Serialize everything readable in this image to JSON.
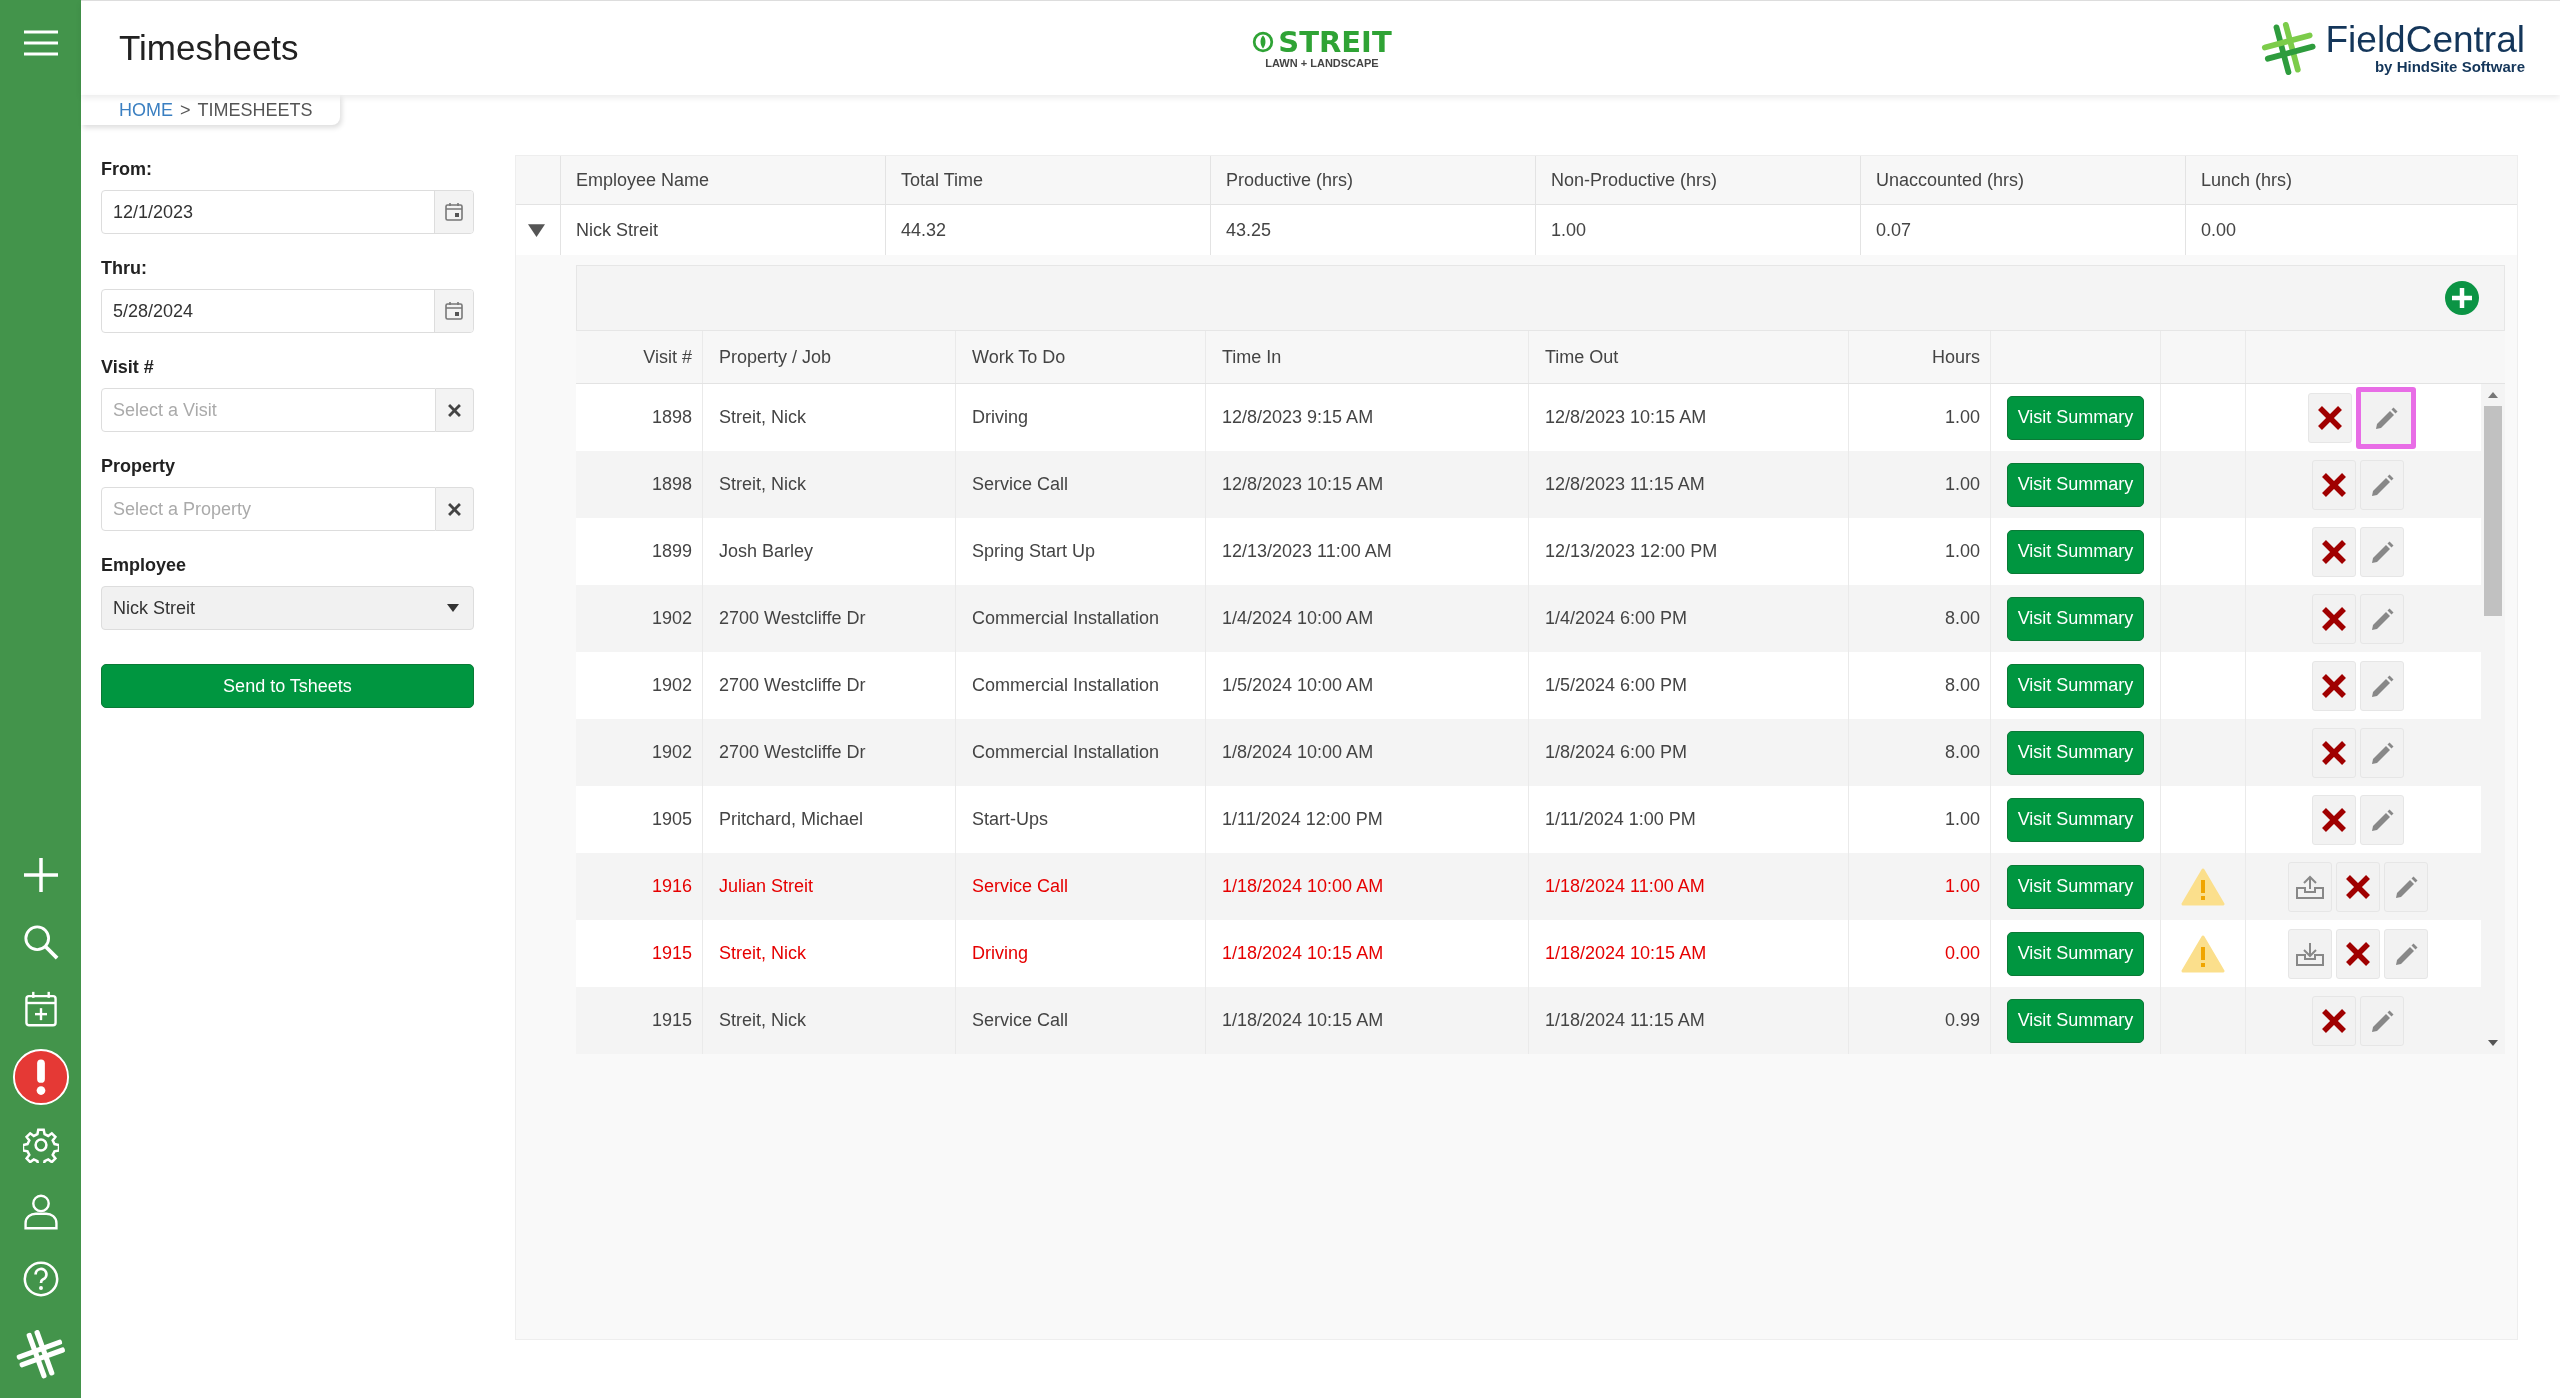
{
  "header": {
    "page_title": "Timesheets",
    "brand_logo": {
      "name": "STREIT",
      "tagline": "LAWN + LANDSCAPE"
    },
    "vendor_logo": {
      "name": "FieldCentral",
      "tagline": "by HindSite Software"
    }
  },
  "breadcrumb": {
    "home": "HOME",
    "separator": ">",
    "current": "TIMESHEETS"
  },
  "filters": {
    "from": {
      "label": "From:",
      "value": "12/1/2023"
    },
    "thru": {
      "label": "Thru:",
      "value": "5/28/2024"
    },
    "visit": {
      "label": "Visit #",
      "placeholder": "Select a Visit"
    },
    "property": {
      "label": "Property",
      "placeholder": "Select a Property"
    },
    "employee": {
      "label": "Employee",
      "value": "Nick Streit"
    },
    "send_button": "Send to Tsheets"
  },
  "summary": {
    "columns": [
      "Employee Name",
      "Total Time",
      "Productive (hrs)",
      "Non-Productive (hrs)",
      "Unaccounted (hrs)",
      "Lunch (hrs)"
    ],
    "rows": [
      {
        "expanded": true,
        "cells": [
          "Nick Streit",
          "44.32",
          "43.25",
          "1.00",
          "0.07",
          "0.00"
        ]
      }
    ]
  },
  "detail": {
    "columns": [
      "Visit #",
      "Property / Job",
      "Work To Do",
      "Time In",
      "Time Out",
      "Hours"
    ],
    "rows": [
      {
        "visit": "1898",
        "property": "Streit, Nick",
        "work": "Driving",
        "time_in": "12/8/2023 9:15 AM",
        "time_out": "12/8/2023 10:15 AM",
        "hours": "1.00",
        "button": "Visit Summary",
        "flagged": false,
        "highlighted": true
      },
      {
        "visit": "1898",
        "property": "Streit, Nick",
        "work": "Service Call",
        "time_in": "12/8/2023 10:15 AM",
        "time_out": "12/8/2023 11:15 AM",
        "hours": "1.00",
        "button": "Visit Summary",
        "flagged": false,
        "highlighted": false
      },
      {
        "visit": "1899",
        "property": "Josh Barley",
        "work": "Spring Start Up",
        "time_in": "12/13/2023 11:00 AM",
        "time_out": "12/13/2023 12:00 PM",
        "hours": "1.00",
        "button": "Visit Summary",
        "flagged": false,
        "highlighted": false
      },
      {
        "visit": "1902",
        "property": "2700 Westcliffe Dr",
        "work": "Commercial Installation",
        "time_in": "1/4/2024 10:00 AM",
        "time_out": "1/4/2024 6:00 PM",
        "hours": "8.00",
        "button": "Visit Summary",
        "flagged": false,
        "highlighted": false
      },
      {
        "visit": "1902",
        "property": "2700 Westcliffe Dr",
        "work": "Commercial Installation",
        "time_in": "1/5/2024 10:00 AM",
        "time_out": "1/5/2024 6:00 PM",
        "hours": "8.00",
        "button": "Visit Summary",
        "flagged": false,
        "highlighted": false
      },
      {
        "visit": "1902",
        "property": "2700 Westcliffe Dr",
        "work": "Commercial Installation",
        "time_in": "1/8/2024 10:00 AM",
        "time_out": "1/8/2024 6:00 PM",
        "hours": "8.00",
        "button": "Visit Summary",
        "flagged": false,
        "highlighted": false
      },
      {
        "visit": "1905",
        "property": "Pritchard, Michael",
        "work": "Start-Ups",
        "time_in": "1/11/2024 12:00 PM",
        "time_out": "1/11/2024 1:00 PM",
        "hours": "1.00",
        "button": "Visit Summary",
        "flagged": false,
        "highlighted": false
      },
      {
        "visit": "1916",
        "property": "Julian Streit",
        "work": "Service Call",
        "time_in": "1/18/2024 10:00 AM",
        "time_out": "1/18/2024 11:00 AM",
        "hours": "1.00",
        "button": "Visit Summary",
        "flagged": true,
        "kind": "upload",
        "highlighted": false
      },
      {
        "visit": "1915",
        "property": "Streit, Nick",
        "work": "Driving",
        "time_in": "1/18/2024 10:15 AM",
        "time_out": "1/18/2024 10:15 AM",
        "hours": "0.00",
        "button": "Visit Summary",
        "flagged": true,
        "kind": "download",
        "highlighted": false
      },
      {
        "visit": "1915",
        "property": "Streit, Nick",
        "work": "Service Call",
        "time_in": "1/18/2024 10:15 AM",
        "time_out": "1/18/2024 11:15 AM",
        "hours": "0.99",
        "button": "Visit Summary",
        "flagged": false,
        "highlighted": false
      }
    ]
  }
}
